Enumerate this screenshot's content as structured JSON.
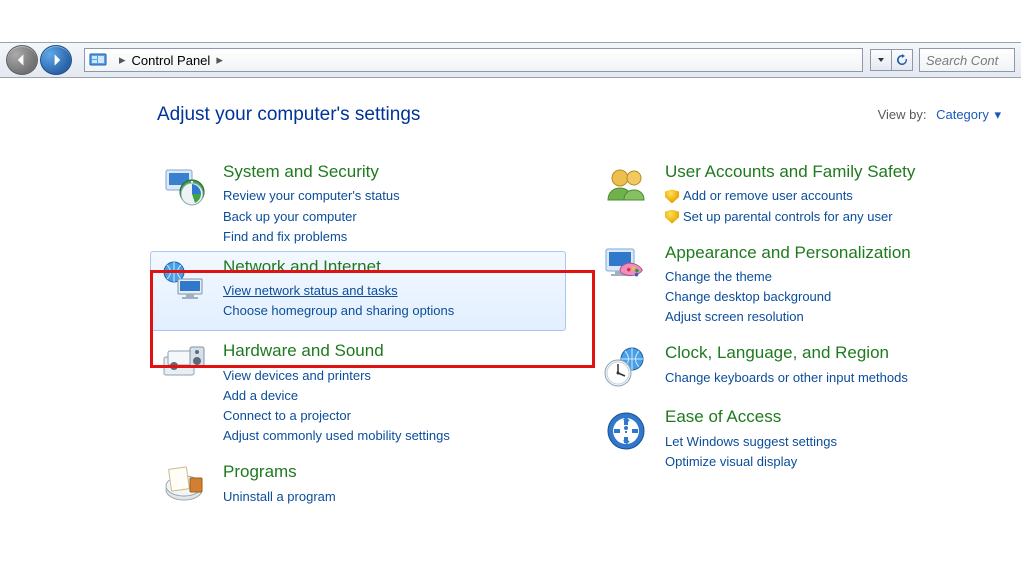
{
  "nav": {
    "breadcrumb_root": "Control Panel",
    "search_placeholder": "Search Cont"
  },
  "header": {
    "title": "Adjust your computer's settings",
    "viewby_label": "View by:",
    "viewby_value": "Category"
  },
  "categories_left": [
    {
      "id": "system-security",
      "title": "System and Security",
      "icon": "system-security-icon",
      "links": [
        {
          "text": "Review your computer's status"
        },
        {
          "text": "Back up your computer"
        },
        {
          "text": "Find and fix problems"
        }
      ]
    },
    {
      "id": "network-internet",
      "title": "Network and Internet",
      "icon": "network-internet-icon",
      "hovered": true,
      "links": [
        {
          "text": "View network status and tasks",
          "emphasis": true
        },
        {
          "text": "Choose homegroup and sharing options"
        }
      ]
    },
    {
      "id": "hardware-sound",
      "title": "Hardware and Sound",
      "icon": "hardware-sound-icon",
      "links": [
        {
          "text": "View devices and printers"
        },
        {
          "text": "Add a device"
        },
        {
          "text": "Connect to a projector"
        },
        {
          "text": "Adjust commonly used mobility settings"
        }
      ]
    },
    {
      "id": "programs",
      "title": "Programs",
      "icon": "programs-icon",
      "links": [
        {
          "text": "Uninstall a program"
        }
      ]
    }
  ],
  "categories_right": [
    {
      "id": "user-accounts",
      "title": "User Accounts and Family Safety",
      "icon": "user-accounts-icon",
      "links": [
        {
          "text": "Add or remove user accounts",
          "shield": true
        },
        {
          "text": "Set up parental controls for any user",
          "shield": true
        }
      ]
    },
    {
      "id": "appearance",
      "title": "Appearance and Personalization",
      "icon": "appearance-icon",
      "links": [
        {
          "text": "Change the theme"
        },
        {
          "text": "Change desktop background"
        },
        {
          "text": "Adjust screen resolution"
        }
      ]
    },
    {
      "id": "clock-language",
      "title": "Clock, Language, and Region",
      "icon": "clock-language-icon",
      "links": [
        {
          "text": "Change keyboards or other input methods"
        }
      ]
    },
    {
      "id": "ease-of-access",
      "title": "Ease of Access",
      "icon": "ease-of-access-icon",
      "links": [
        {
          "text": "Let Windows suggest settings"
        },
        {
          "text": "Optimize visual display"
        }
      ]
    }
  ]
}
